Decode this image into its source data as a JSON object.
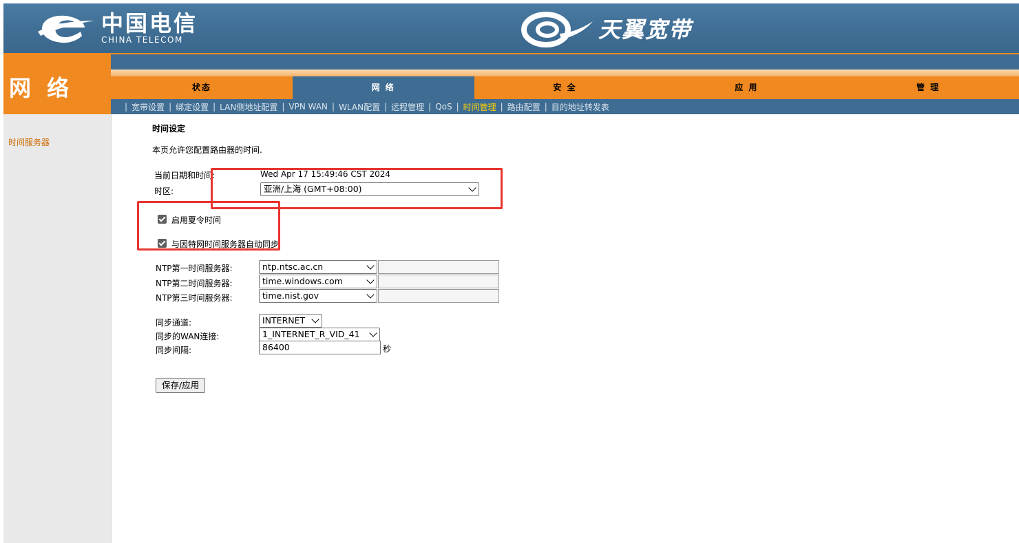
{
  "brand": {
    "china_telecom_cn": "中国电信",
    "china_telecom_en": "CHINA TELECOM",
    "tianyi": "天翼宽带",
    "colors": {
      "header_blue": "#3f6c92",
      "orange": "#f0891f",
      "annotation_red": "#e8352f",
      "link_orange": "#cc6a00",
      "current_yellow": "#ffd400"
    }
  },
  "section_title": "网 络",
  "nav": {
    "tabs": [
      {
        "label": "状态"
      },
      {
        "label": "网 络"
      },
      {
        "label": "安 全"
      },
      {
        "label": "应 用"
      },
      {
        "label": "管 理"
      }
    ],
    "sub_items": [
      {
        "label": "宽带设置"
      },
      {
        "label": "绑定设置"
      },
      {
        "label": "LAN侧地址配置"
      },
      {
        "label": "VPN WAN"
      },
      {
        "label": "WLAN配置"
      },
      {
        "label": "远程管理"
      },
      {
        "label": "QoS"
      },
      {
        "label": "时间管理"
      },
      {
        "label": "路由配置"
      },
      {
        "label": "目的地址转发表"
      }
    ]
  },
  "sidebar": {
    "items": [
      {
        "label": "时间服务器"
      }
    ]
  },
  "content": {
    "heading": "时间设定",
    "description": "本页允许您配置路由器的时间.",
    "current_time_label": "当前日期和时间:",
    "current_time_value": "Wed Apr 17 15:49:46 CST 2024",
    "timezone_label": "时区:",
    "timezone_value": "亚洲/上海 (GMT+08:00)",
    "dst_label": "启用夏令时间",
    "ntp_sync_label": "与因特网时间服务器自动同步",
    "ntp1_label": "NTP第一时间服务器:",
    "ntp1_value": "ntp.ntsc.ac.cn",
    "ntp2_label": "NTP第二时间服务器:",
    "ntp2_value": "time.windows.com",
    "ntp3_label": "NTP第三时间服务器:",
    "ntp3_value": "time.nist.gov",
    "sync_channel_label": "同步通道:",
    "sync_channel_value": "INTERNET",
    "sync_wan_label": "同步的WAN连接:",
    "sync_wan_value": "1_INTERNET_R_VID_41",
    "sync_interval_label": "同步间隔:",
    "sync_interval_value": "86400",
    "sync_interval_unit": "秒",
    "save_button": "保存/应用"
  }
}
